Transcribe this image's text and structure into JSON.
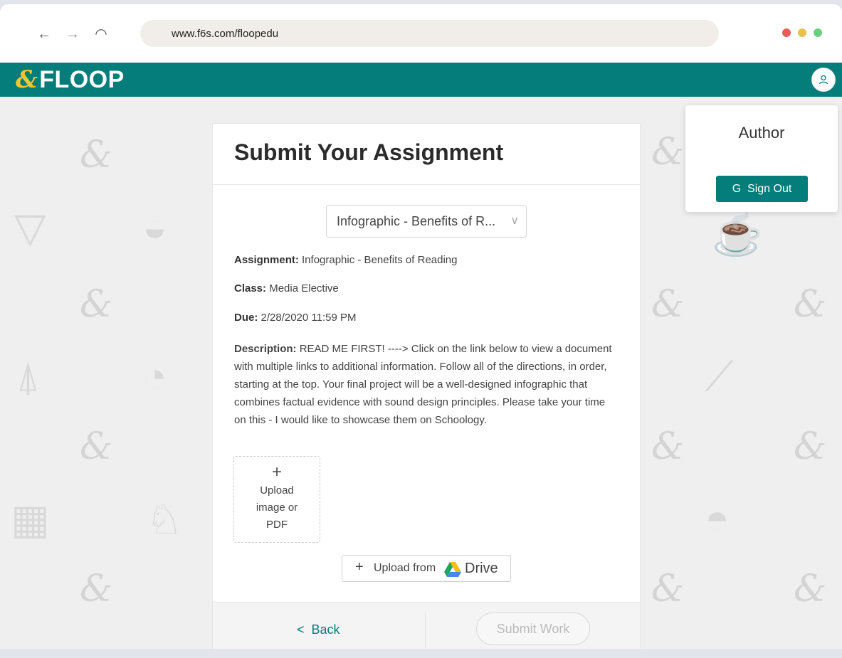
{
  "browser": {
    "url": "www.f6s.com/floopedu",
    "back_icon": "←",
    "forward_icon": "→",
    "reload_icon": "◠",
    "window_dots": [
      "#ee5a58",
      "#e7c24a",
      "#6bd07c"
    ]
  },
  "app": {
    "logo_mark": "&",
    "logo_text": "FLOOP",
    "brand_color": "#057d7b",
    "avatar_icon": "user-icon"
  },
  "user_menu": {
    "role": "Author",
    "sign_out_label": "Sign Out",
    "sign_out_icon": "G"
  },
  "assignment": {
    "page_title": "Submit Your Assignment",
    "selected": "Infographic - Benefits of R...",
    "assignment_label": "Assignment:",
    "assignment_value": "Infographic - Benefits of Reading",
    "class_label": "Class:",
    "class_value": "Media Elective",
    "due_label": "Due:",
    "due_value": "2/28/2020 11:59 PM",
    "description_label": "Description:",
    "description_value": "READ ME FIRST! ----> Click on the link below to view a document with multiple links to additional information. Follow all of the directions, in order, starting at the top. Your final project will be a well-designed infographic that combines factual evidence with sound design principles. Please take your time on this - I would like to showcase them on Schoology."
  },
  "upload": {
    "plus": "+",
    "label": "Upload image or PDF",
    "drive_prefix": "Upload from",
    "drive_name": "Drive"
  },
  "footer": {
    "back_label": "Back",
    "back_icon": "<",
    "submit_label": "Submit Work"
  }
}
